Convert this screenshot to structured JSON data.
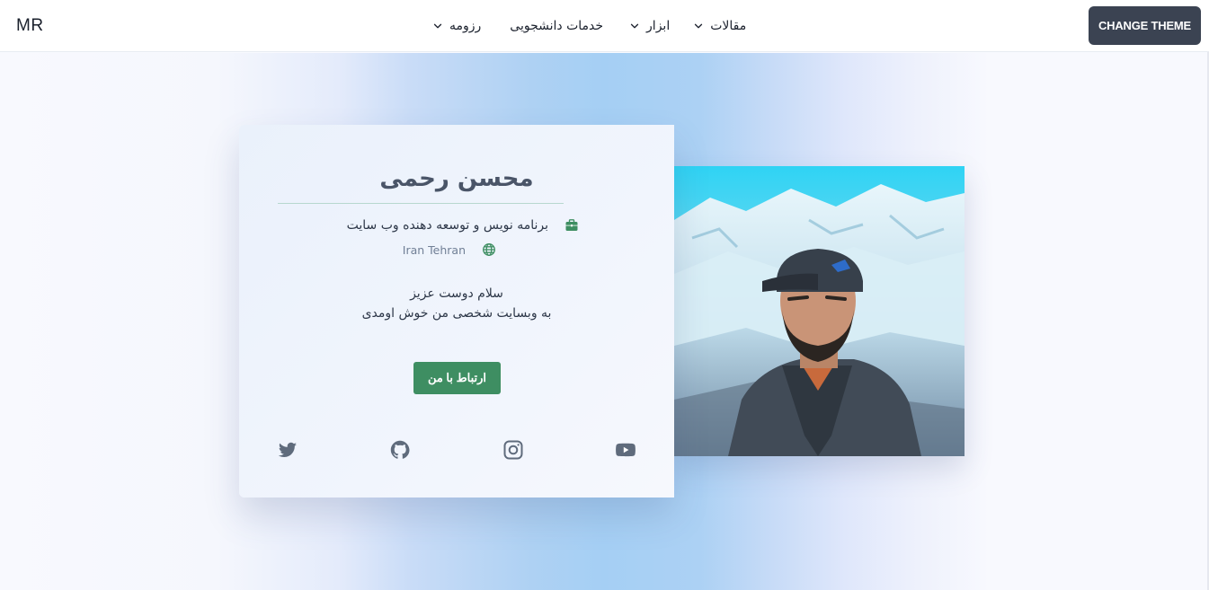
{
  "header": {
    "logo": "MR",
    "nav": [
      {
        "label": "مقالات"
      },
      {
        "label": "ابزار"
      },
      {
        "label": "خدمات دانشجویی"
      },
      {
        "label": "رزومه"
      }
    ],
    "theme_button": "CHANGE THEME"
  },
  "profile": {
    "name": "محسن رحمی",
    "job": "برنامه نویس و توسعه دهنده وب سایت",
    "location": "Iran Tehran",
    "greeting_line1": "سلام دوست عزیز",
    "greeting_line2": "به وبسایت شخصی من خوش اومدی",
    "contact_button": "ارتباط با من"
  },
  "social": [
    {
      "icon": "twitter-icon"
    },
    {
      "icon": "github-icon"
    },
    {
      "icon": "instagram-icon"
    },
    {
      "icon": "youtube-icon"
    }
  ],
  "colors": {
    "accent_green": "#3e8e62",
    "theme_button_bg": "#3b4352",
    "icon_gray": "#5f6b7c"
  }
}
